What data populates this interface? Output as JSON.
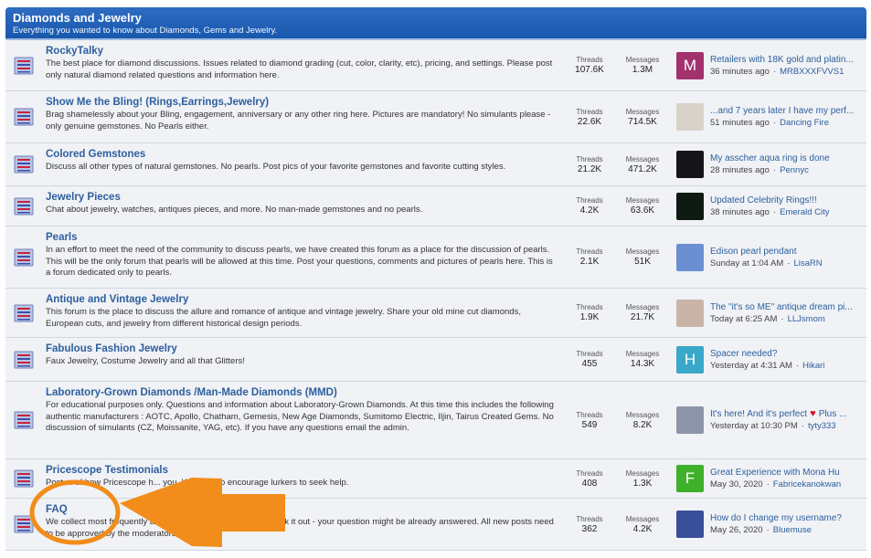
{
  "category": {
    "title": "Diamonds and Jewelry",
    "description": "Everything you wanted to know about Diamonds, Gems and Jewelry."
  },
  "labels": {
    "threads": "Threads",
    "messages": "Messages",
    "dot": "·"
  },
  "forums": [
    {
      "name": "RockyTalky",
      "desc": "The best place for diamond discussions. Issues related to diamond grading (cut, color, clarity, etc), pricing, and settings. Please post only natural diamond related questions and information here.",
      "threads": "107.6K",
      "messages": "1.3M",
      "last_thread": "Retailers with 18K gold and platin...",
      "last_time": "36 minutes ago",
      "last_user": "MRBXXXFVVS1",
      "avatar_letter": "M",
      "avatar_color": "#a2316e"
    },
    {
      "name": "Show Me the Bling! (Rings,Earrings,Jewelry)",
      "desc": "Brag shamelessly about your Bling, engagement, anniversary or any other ring here. Pictures are mandatory! No simulants please - only genuine gemstones. No Pearls either.",
      "threads": "22.6K",
      "messages": "714.5K",
      "last_thread": "...and 7 years later I have my perf...",
      "last_time": "51 minutes ago",
      "last_user": "Dancing Fire",
      "avatar_letter": "",
      "avatar_color": "#d9d2c8"
    },
    {
      "name": "Colored Gemstones",
      "desc": "Discuss all other types of natural gemstones. No pearls. Post pics of your favorite gemstones and favorite cutting styles.",
      "threads": "21.2K",
      "messages": "471.2K",
      "last_thread": "My asscher aqua ring is done",
      "last_time": "28 minutes ago",
      "last_user": "Pennyc",
      "avatar_letter": "",
      "avatar_color": "#15151a"
    },
    {
      "name": "Jewelry Pieces",
      "desc": "Chat about jewelry, watches, antiques pieces, and more. No man-made gemstones and no pearls.",
      "threads": "4.2K",
      "messages": "63.6K",
      "last_thread": "Updated Celebrity Rings!!!",
      "last_time": "38 minutes ago",
      "last_user": "Emerald City",
      "avatar_letter": "",
      "avatar_color": "#0f1a12"
    },
    {
      "name": "Pearls",
      "desc": "In an effort to meet the need of the community to discuss pearls, we have created this forum as a place for the discussion of pearls.  This will be the only forum that pearls will be allowed at this time.  Post your questions, comments and pictures of pearls here.  This is a forum dedicated only to pearls.",
      "threads": "2.1K",
      "messages": "51K",
      "last_thread": "Edison pearl pendant",
      "last_time": "Sunday at 1:04 AM",
      "last_user": "LisaRN",
      "avatar_letter": "",
      "avatar_color": "#6b8fd1"
    },
    {
      "name": "Antique and Vintage Jewelry",
      "desc": "This forum is the place to discuss the allure and romance of antique and vintage jewelry. Share your old mine cut diamonds, European cuts, and jewelry from different historical design periods.",
      "threads": "1.9K",
      "messages": "21.7K",
      "last_thread": "The \"it's so ME\" antique dream pi...",
      "last_time": "Today at 6:25 AM",
      "last_user": "LLJsmom",
      "avatar_letter": "",
      "avatar_color": "#c9b5a8"
    },
    {
      "name": "Fabulous Fashion Jewelry",
      "desc": "Faux Jewelry, Costume Jewelry and all that Glitters!",
      "threads": "455",
      "messages": "14.3K",
      "last_thread": "Spacer needed?",
      "last_time": "Yesterday at 4:31 AM",
      "last_user": "Hikari",
      "avatar_letter": "H",
      "avatar_color": "#3aa9c9"
    },
    {
      "name": "Laboratory-Grown Diamonds /Man-Made Diamonds (MMD)",
      "desc": "For educational purposes only. Questions and information about Laboratory-Grown Diamonds. At this time this includes the following authentic manufacturers : AOTC, Apollo, Chatham, Gemesis, New Age Diamonds, Sumitomo Electric, Iljin, Tairus Created Gems. No discussion of simulants (CZ, Moissanite, YAG, etc). If you have any questions email the admin.",
      "threads": "549",
      "messages": "8.2K",
      "last_thread": "It's here! And it's perfect",
      "last_thread_suffix": "Plus ...",
      "last_time": "Yesterday at 10:30 PM",
      "last_user": "tyty333",
      "avatar_letter": "",
      "avatar_color": "#8d96a8"
    },
    {
      "name": "Pricescope Testimonials",
      "desc": "Post ... of how Pricescope h... you. We want to encourage lurkers to seek help.",
      "threads": "408",
      "messages": "1.3K",
      "last_thread": "Great Experience with Mona Hu",
      "last_time": "May 30, 2020",
      "last_user": "Fabricekanokwan",
      "avatar_letter": "F",
      "avatar_color": "#3fb029"
    },
    {
      "name": "FAQ",
      "desc": "We collect most frequently asked questions here. Please check it out - your question might be already answered. All new posts need to be approved by the moderators.",
      "threads": "362",
      "messages": "4.2K",
      "last_thread": "How do I change my username?",
      "last_time": "May 26, 2020",
      "last_user": "Bluemuse",
      "avatar_letter": "",
      "avatar_color": "#3a4f9a"
    }
  ],
  "overlay": {
    "color": "#f28c1a"
  }
}
